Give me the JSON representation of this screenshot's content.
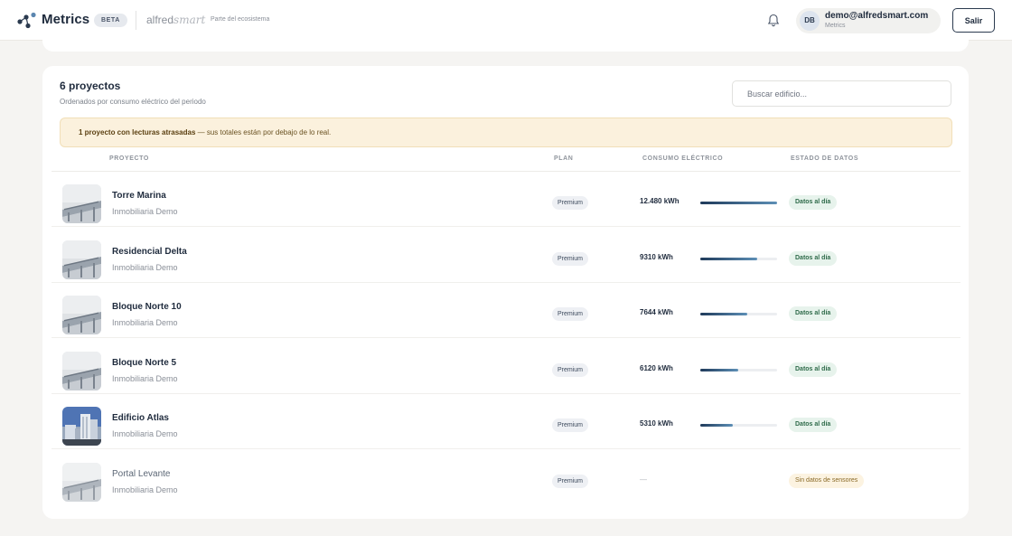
{
  "header": {
    "brand": "Metrics",
    "badge": "BETA",
    "partner_alfred": "alfred",
    "partner_smart": "smart",
    "partner_tagline": "Parte del ecosistema",
    "user_initials": "DB",
    "user_email": "demo@alfredsmart.com",
    "user_app": "Metrics",
    "logout_label": "Salir"
  },
  "projects": {
    "title": "6 proyectos",
    "subtitle": "Ordenados por consumo eléctrico del periodo",
    "search_placeholder": "Buscar edificio...",
    "alert_bold": "1 proyecto con lecturas atrasadas",
    "alert_rest": " — sus totales están por debajo de lo real.",
    "columns": [
      "PROYECTO",
      "PLAN",
      "CONSUMO ELÉCTRICO",
      "ESTADO DE DATOS"
    ],
    "rows": [
      {
        "name": "Torre Marina",
        "company": "Inmobiliaria Demo",
        "plan": "Premium",
        "consumption": "12.480 kWh",
        "fraction": 1.0,
        "status": "Datos al día",
        "state": "ok",
        "thumb": "building-photo"
      },
      {
        "name": "Residencial Delta",
        "company": "Inmobiliaria Demo",
        "plan": "Premium",
        "consumption": "9310 kWh",
        "fraction": 0.746,
        "status": "Datos al día",
        "state": "ok",
        "thumb": "building-photo"
      },
      {
        "name": "Bloque Norte 10",
        "company": "Inmobiliaria Demo",
        "plan": "Premium",
        "consumption": "7644 kWh",
        "fraction": 0.612,
        "status": "Datos al día",
        "state": "ok",
        "thumb": "building-photo"
      },
      {
        "name": "Bloque Norte 5",
        "company": "Inmobiliaria Demo",
        "plan": "Premium",
        "consumption": "6120 kWh",
        "fraction": 0.49,
        "status": "Datos al día",
        "state": "ok",
        "thumb": "building-photo"
      },
      {
        "name": "Edificio Atlas",
        "company": "Inmobiliaria Demo",
        "plan": "Premium",
        "consumption": "5310 kWh",
        "fraction": 0.425,
        "status": "Datos al día",
        "state": "ok",
        "thumb": "city-photo"
      },
      {
        "name": "Portal Levante",
        "company": "Inmobiliaria Demo",
        "plan": "Premium",
        "consumption": "—",
        "fraction": null,
        "status": "Sin datos de sensores",
        "state": "warn",
        "thumb": "building-photo"
      }
    ]
  },
  "colors": {
    "accent": "#1f2b3d",
    "ok_bg": "#e7f3ec",
    "warn_bg": "#fcf3e1",
    "alert_bg": "#fbf1dd"
  },
  "icons": {
    "logo": "metrics-logo-icon",
    "bell": "bell-icon"
  }
}
